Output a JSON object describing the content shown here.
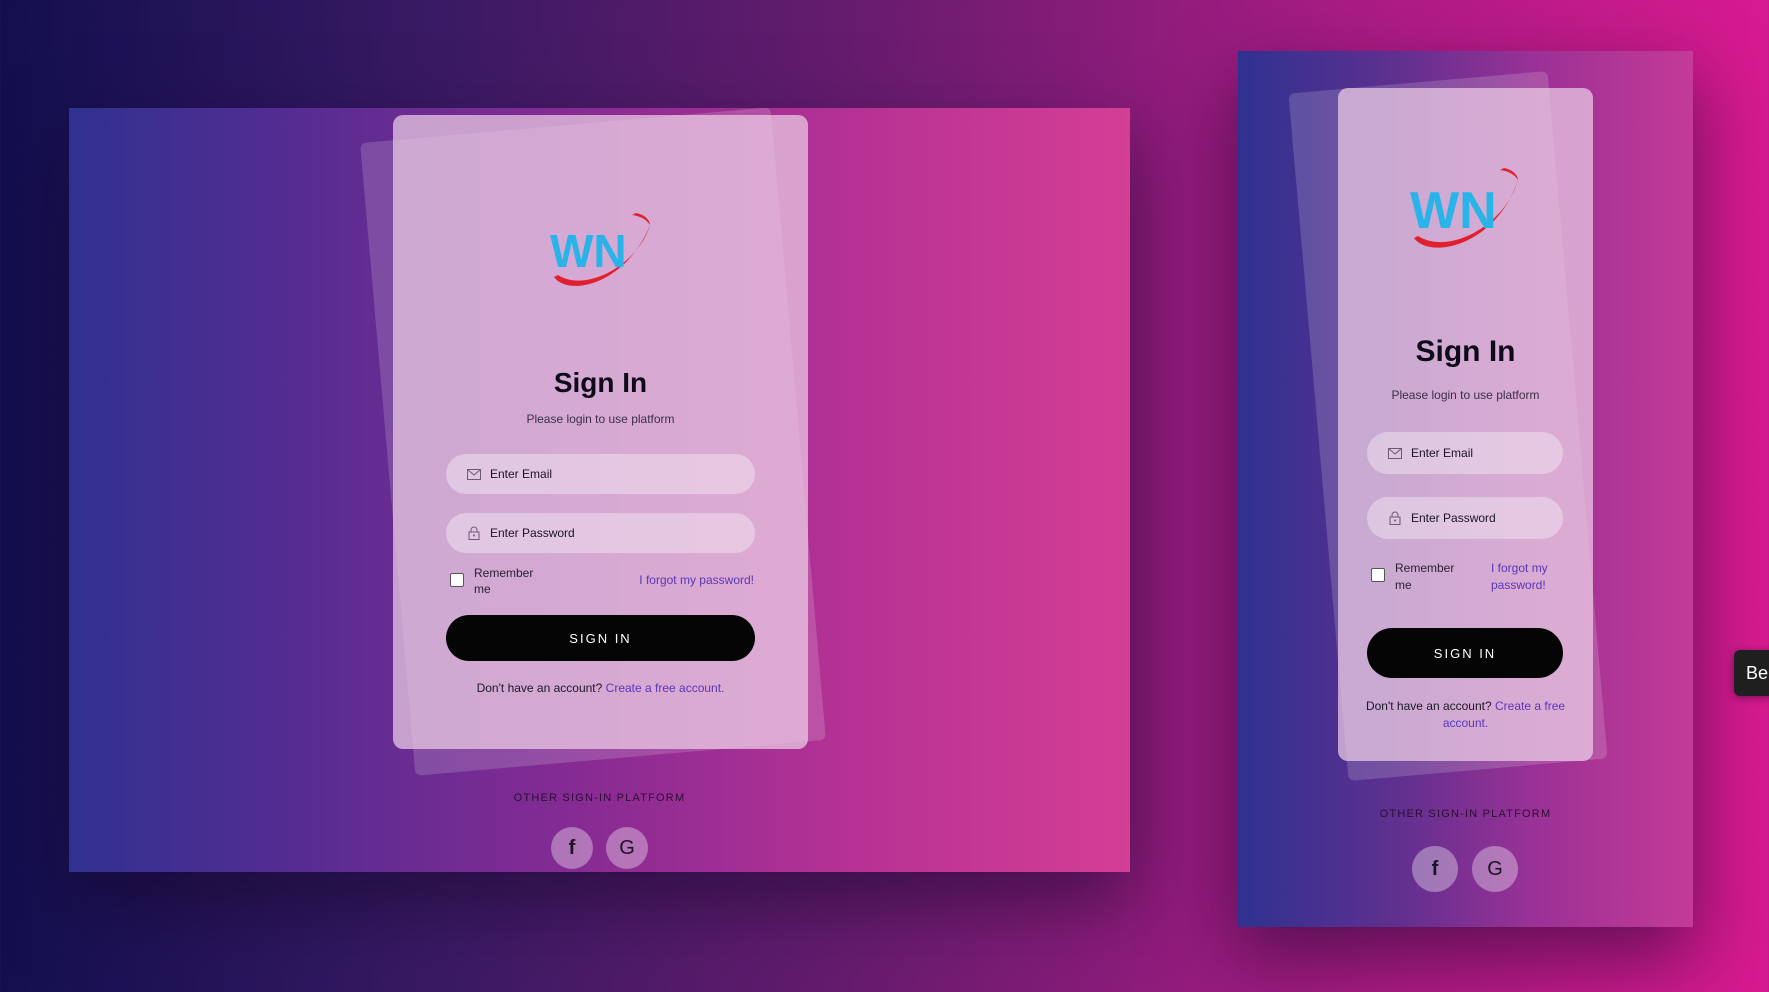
{
  "colors": {
    "accent_link": "#5a36b8",
    "button": "#050505",
    "logo_blue": "#28b4e8",
    "logo_red": "#e0202e"
  },
  "desktop": {
    "logo": {
      "text": "WN",
      "icon": "wn-logo"
    },
    "title": "Sign In",
    "subtitle": "Please login to use platform",
    "email_placeholder": "Enter Email",
    "password_placeholder": "Enter Password",
    "remember_label": "Remember me",
    "forgot_label": "I forgot my password!",
    "signin_button": "SIGN IN",
    "account_prompt": "Don't have an account?",
    "create_account_link": "Create a free account.",
    "other_platform_label": "OTHER SIGN-IN PLATFORM",
    "social": [
      {
        "name": "facebook",
        "glyph": "f"
      },
      {
        "name": "google",
        "glyph": "G"
      }
    ]
  },
  "mobile": {
    "logo": {
      "text": "WN",
      "icon": "wn-logo"
    },
    "title": "Sign In",
    "subtitle": "Please login to use platform",
    "email_placeholder": "Enter Email",
    "password_placeholder": "Enter Password",
    "remember_label": "Remember me",
    "forgot_label": "I forgot my password!",
    "signin_button": "SIGN IN",
    "account_prompt": "Don't have an account?",
    "create_account_link": "Create a free account.",
    "other_platform_label": "OTHER SIGN-IN PLATFORM",
    "social": [
      {
        "name": "facebook",
        "glyph": "f"
      },
      {
        "name": "google",
        "glyph": "G"
      }
    ]
  },
  "tooltip": {
    "text": "Ber"
  }
}
